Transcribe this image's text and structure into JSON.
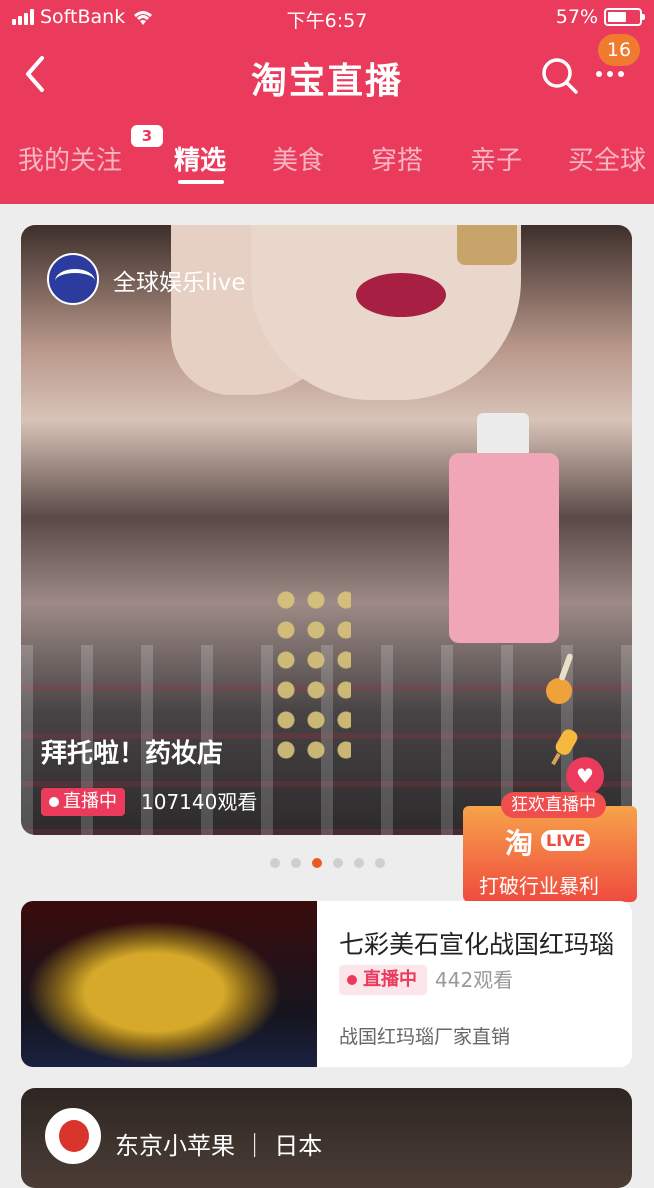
{
  "status_bar": {
    "carrier": "SoftBank",
    "time": "下午6:57",
    "battery": "57%"
  },
  "navbar": {
    "title": "淘宝直播",
    "notification_count": "16"
  },
  "tabs": [
    {
      "label": "我的关注",
      "badge": "3"
    },
    {
      "label": "精选",
      "active": true
    },
    {
      "label": "美食"
    },
    {
      "label": "穿搭"
    },
    {
      "label": "亲子"
    },
    {
      "label": "买全球"
    }
  ],
  "featured": {
    "anchor_name": "全球娱乐live",
    "title": "拜托啦！药妆店",
    "live_label": "直播中",
    "views": "107140观看"
  },
  "carousel": {
    "count": 6,
    "active_index": 2
  },
  "promo": {
    "tag": "狂欢直播中",
    "logo": "淘",
    "live": "LIVE",
    "text": "打破行业暴利"
  },
  "list": [
    {
      "title": "七彩美石宣化战国红玛瑙",
      "live_label": "直播中",
      "views": "442观看",
      "subtitle": "战国红玛瑙厂家直销"
    }
  ],
  "card3": {
    "anchor_name": "东京小苹果 ｜ 日本"
  },
  "colors": {
    "brand": "#ea3b5c",
    "promo_orange": "#ef4b3f",
    "active_dot": "#e85c24"
  }
}
